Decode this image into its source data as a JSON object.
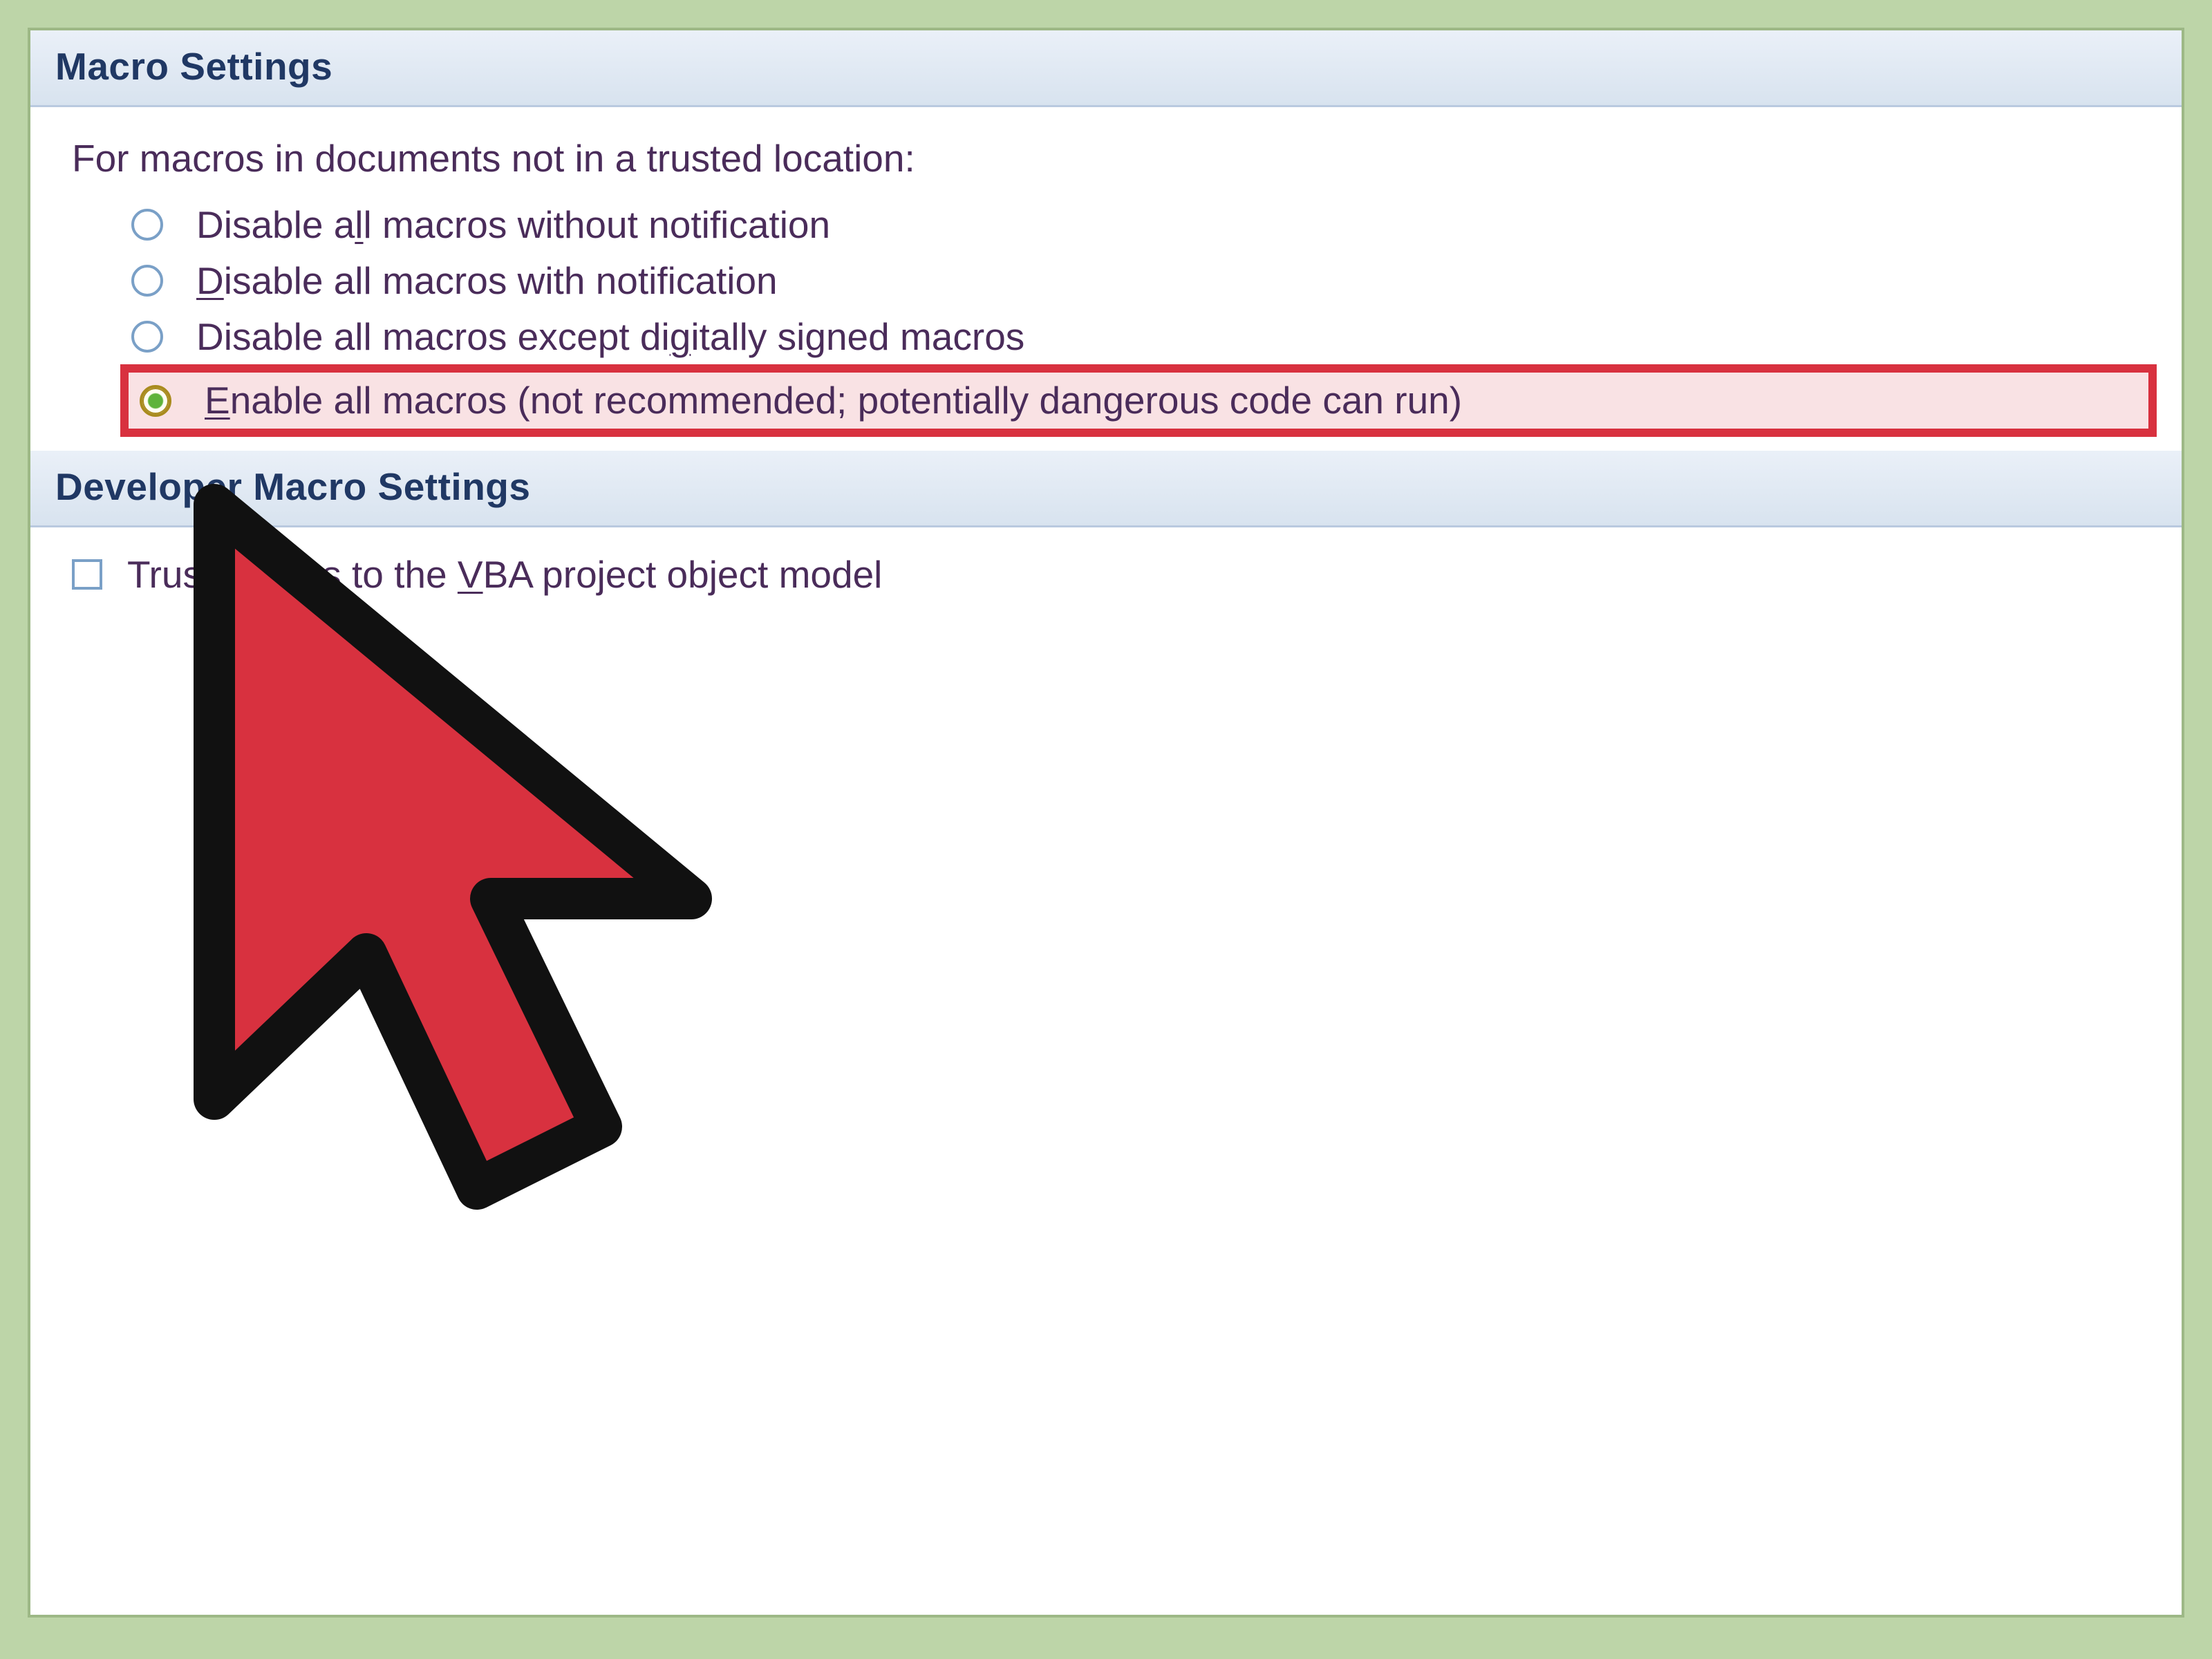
{
  "sections": {
    "macro": {
      "title": "Macro Settings",
      "intro": "For macros in documents not in a trusted location:",
      "options": [
        {
          "label_pre": "Disable a",
          "mnemonic": "l",
          "label_post": "l macros without notification",
          "selected": false,
          "highlighted": false
        },
        {
          "label_pre": "",
          "mnemonic": "D",
          "label_post": "isable all macros with notification",
          "selected": false,
          "highlighted": false
        },
        {
          "label_pre": "Disable all macros except di",
          "mnemonic": "g",
          "label_post": "itally signed macros",
          "selected": false,
          "highlighted": false
        },
        {
          "label_pre": "",
          "mnemonic": "E",
          "label_post": "nable all macros (not recommended; potentially dangerous code can run)",
          "selected": true,
          "highlighted": true
        }
      ]
    },
    "developer": {
      "title": "Developer Macro Settings",
      "checkbox": {
        "label_pre": "Trust access to the ",
        "mnemonic": "V",
        "label_post": "BA project object model",
        "checked": false
      }
    }
  },
  "annotation": {
    "highlight_color": "#d8313f"
  }
}
